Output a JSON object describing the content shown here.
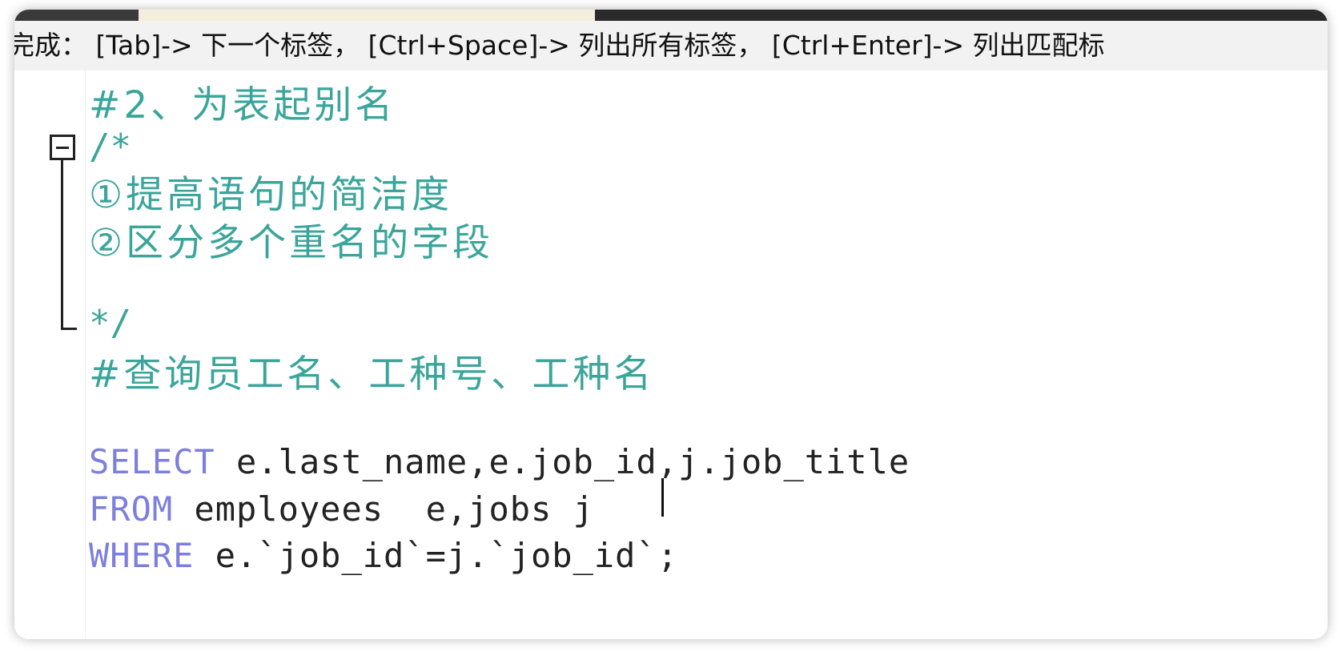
{
  "hint_bar": {
    "text": "完成：  [Tab]-> 下一个标签，  [Ctrl+Space]-> 列出所有标签，  [Ctrl+Enter]-> 列出匹配标"
  },
  "editor": {
    "lines": [
      {
        "text": "#2、为表起别名"
      },
      {
        "text": "/*"
      },
      {
        "text": "①提高语句的简洁度"
      },
      {
        "text": "②区分多个重名的字段"
      },
      {
        "text": "*/"
      },
      {
        "text": "#查询员工名、工种号、工种名"
      }
    ],
    "sql": {
      "select_kw": "SELECT",
      "select_rest": " e.last_name,e.job_id,j.job_title",
      "from_kw": "FROM",
      "from_rest": " employees  e,jobs j",
      "where_kw": "WHERE",
      "where_rest": " e.`job_id`=j.`job_id`;"
    }
  },
  "colors": {
    "comment": "#3aa59a",
    "keyword": "#7c7fdd",
    "text": "#222222"
  }
}
